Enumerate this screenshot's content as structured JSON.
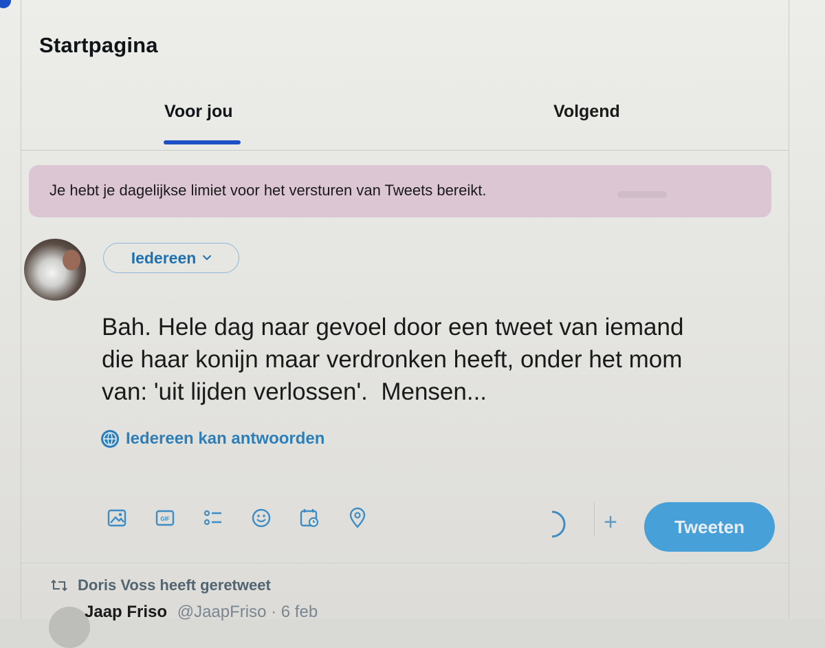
{
  "header": {
    "title": "Startpagina"
  },
  "tabs": [
    {
      "label": "Voor jou",
      "active": true
    },
    {
      "label": "Volgend",
      "active": false
    }
  ],
  "banner": {
    "text": "Je hebt je dagelijkse limiet voor het versturen van Tweets bereikt."
  },
  "composer": {
    "audience_label": "Iedereen",
    "text": "Bah. Hele dag naar gevoel door een tweet van iemand\ndie haar konijn maar verdronken heeft, onder het mom\nvan: 'uit lijden verlossen'.  Mensen...",
    "reply_setting": "Iedereen kan antwoorden",
    "toolbar_icons": [
      "image-icon",
      "gif-icon",
      "poll-icon",
      "emoji-icon",
      "schedule-icon",
      "location-icon"
    ],
    "submit_label": "Tweeten"
  },
  "feed": {
    "retweet_label": "Doris Voss heeft geretweet",
    "next_name": "Jaap Friso",
    "next_handle": "@JaapFriso · 6 feb"
  },
  "colors": {
    "accent": "#1d4fc7",
    "link": "#1d71b0",
    "banner_bg": "#dcc6d4",
    "tweet_button": "#48a0d8"
  }
}
